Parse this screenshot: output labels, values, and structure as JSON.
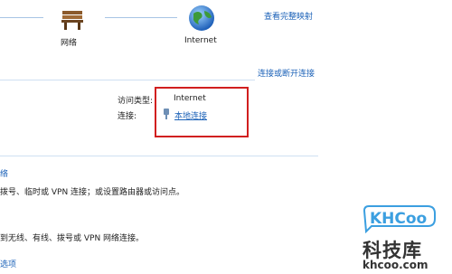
{
  "network_map": {
    "view_full_map": "查看完整映射",
    "network_label": "网络",
    "internet_label": "Internet"
  },
  "connect_disconnect": "连接或断开连接",
  "details": {
    "access_type_label": "访问类型:",
    "access_type_value": "Internet",
    "connections_label": "连接:",
    "connection_link": "本地连接"
  },
  "tasks": {
    "item1_title_fragment": "络",
    "item1_desc_fragment": "拨号、临时或 VPN 连接；或设置路由器或访问点。",
    "item2_desc_fragment": "到无线、有线、拨号或 VPN 网络连接。",
    "item3_title_fragment": "选项"
  },
  "watermark": {
    "logo_text": "KHCoo",
    "brand_cn": "科技库",
    "domain": "khcoo.com"
  },
  "colors": {
    "link": "#1c62b8",
    "highlight_box": "#d11f1f",
    "watermark_blue": "#3b9fe0"
  }
}
